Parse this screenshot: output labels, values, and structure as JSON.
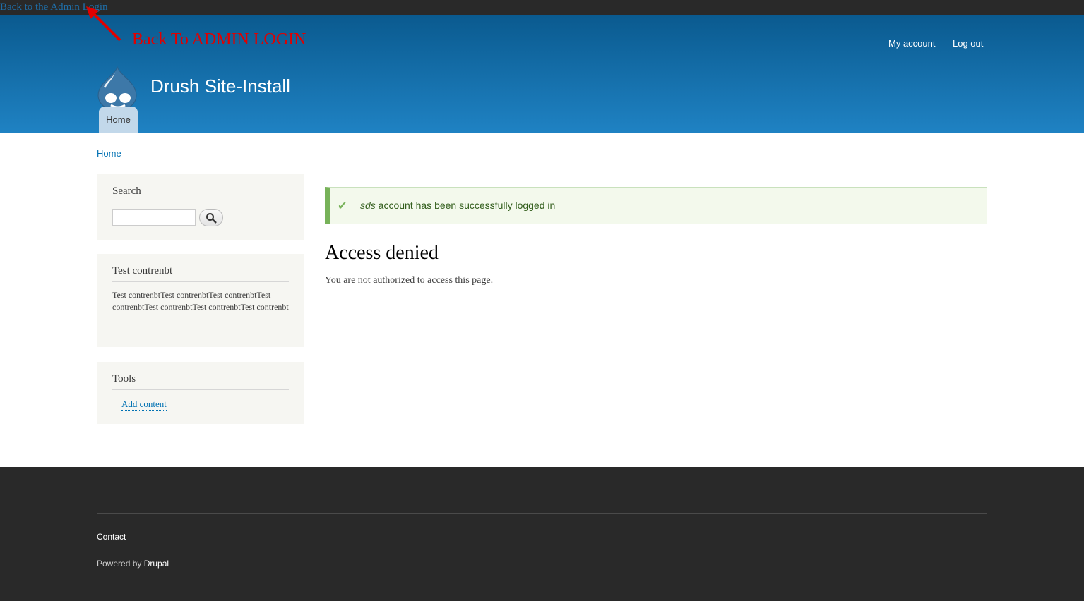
{
  "topbar": {
    "back_link": "Back to the Admin Login"
  },
  "annotation": {
    "text": "Back To ADMIN LOGIN",
    "color": "#e00000"
  },
  "header": {
    "site_name": "Drush Site-Install",
    "my_account": "My account",
    "log_out": "Log out",
    "home_tab": "Home"
  },
  "breadcrumb": {
    "home": "Home"
  },
  "sidebar": {
    "search": {
      "title": "Search",
      "placeholder": ""
    },
    "test": {
      "title": "Test contrenbt",
      "body": "Test contrenbtTest contrenbtTest contrenbtTest contrenbtTest contrenbtTest contrenbtTest contrenbt"
    },
    "tools": {
      "title": "Tools",
      "add_content": "Add content"
    }
  },
  "main": {
    "message_user": "sds",
    "message_rest": " account has been successfully logged in",
    "title": "Access denied",
    "body": "You are not authorized to access this page."
  },
  "footer": {
    "contact": "Contact",
    "powered_by": "Powered by ",
    "drupal": "Drupal"
  }
}
